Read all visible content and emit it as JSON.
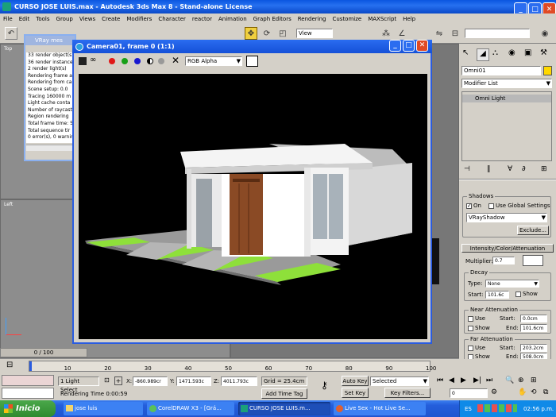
{
  "app": {
    "title": "CURSO JOSE LUIS.max - Autodesk 3ds Max 8  - Stand-alone License"
  },
  "menu": [
    "File",
    "Edit",
    "Tools",
    "Group",
    "Views",
    "Create",
    "Modifiers",
    "Character",
    "reactor",
    "Animation",
    "Graph Editors",
    "Rendering",
    "Customize",
    "MAXScript",
    "Help"
  ],
  "toolbar": {
    "view_dropdown": "View"
  },
  "vray_window": {
    "title": "VRay mes",
    "lines": [
      "33 render object(s)",
      "36 render instance",
      "2 render light(s)",
      "Rendering frame a",
      "Rendering from ca",
      "Scene setup: 0.0",
      "Tracing 160000 m",
      "Light cache conta",
      "Number of raycast",
      "Region rendering",
      "Total frame time: 5",
      "Total sequence tir",
      "0 error(s), 0 warnin"
    ]
  },
  "render_window": {
    "title": "Camera01, frame 0 (1:1)",
    "channel": "RGB Alpha"
  },
  "viewports": {
    "top": "Top",
    "left": "Left"
  },
  "command_panel": {
    "object_name": "Omni01",
    "modifier_list": "Modifier List",
    "stack_item": "Omni Light",
    "shadows": {
      "title": "Shadows",
      "on_label": "On",
      "use_global_label": "Use Global Settings",
      "shadow_type": "VRayShadow",
      "exclude_label": "Exclude..."
    },
    "intensity": {
      "title": "Intensity/Color/Attenuation",
      "multiplier_label": "Multiplier:",
      "multiplier": "0.7"
    },
    "decay": {
      "title": "Decay",
      "type_label": "Type:",
      "type": "None",
      "start_label": "Start:",
      "start": "101.6c",
      "show_label": "Show"
    },
    "near": {
      "title": "Near Attenuation",
      "use_label": "Use",
      "start_label": "Start:",
      "start": "0.0cm",
      "show_label": "Show",
      "end_label": "End:",
      "end": "101.6cm"
    },
    "far": {
      "title": "Far Attenuation",
      "use_label": "Use",
      "start_label": "Start:",
      "start": "203.2cm",
      "show_label": "Show",
      "end_label": "End:",
      "end": "508.0cm"
    }
  },
  "timeline": {
    "frame_counter": "0 / 100",
    "ticks": [
      "10",
      "20",
      "30",
      "40",
      "50",
      "60",
      "70",
      "80",
      "90",
      "100"
    ]
  },
  "status": {
    "selection": "1 Light Select",
    "x_label": "X:",
    "x": "-860.989cr",
    "y_label": "Y:",
    "y": "1471.593c",
    "z_label": "Z:",
    "z": "4011.793c",
    "grid": "Grid = 25.4cm",
    "rendering_time": "Rendering Time  0:00:59",
    "add_time_tag": "Add Time Tag",
    "auto_key": "Auto Key",
    "set_key": "Set Key",
    "selected": "Selected",
    "key_filters": "Key Filters...",
    "frame": "0"
  },
  "taskbar": {
    "start": "Inicio",
    "items": [
      "jose luis",
      "CorelDRAW X3 - [Grá...",
      "CURSO JOSE LUIS.m...",
      "Live Sex - Hot Live Se..."
    ],
    "lang": "ES",
    "clock": "02:56 p.m."
  },
  "colors": {
    "accent": "#245edb",
    "lawn": "#8ee03a",
    "door": "#8a4a25",
    "object_color": "#ffd800"
  }
}
